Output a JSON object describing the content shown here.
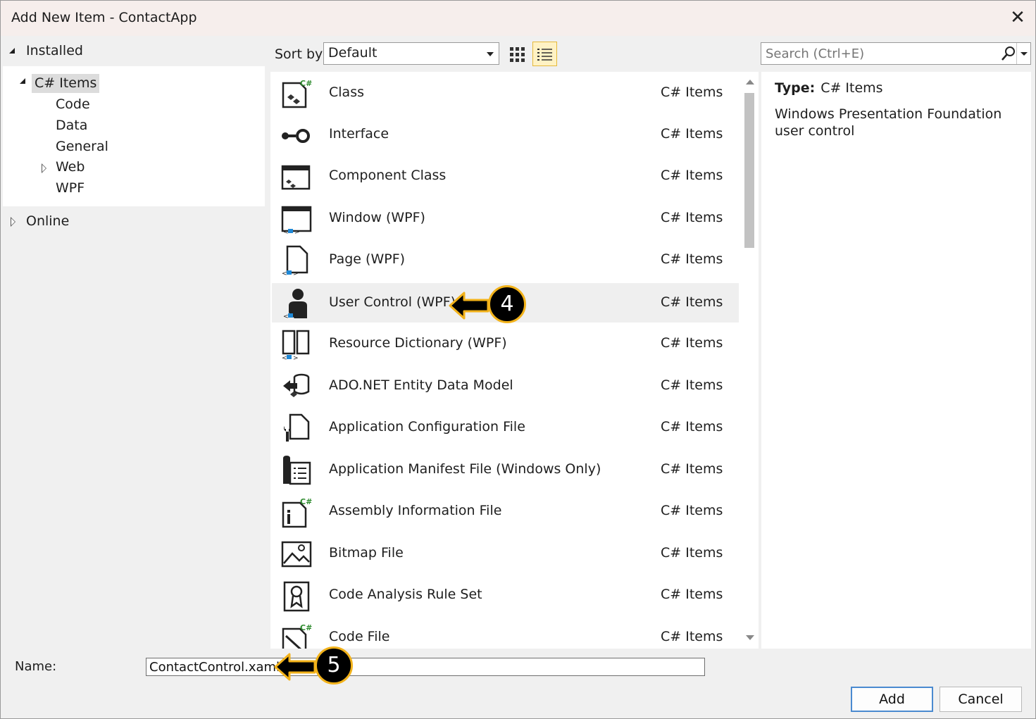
{
  "window": {
    "title": "Add New Item - ContactApp",
    "close_glyph": "✕"
  },
  "tree": {
    "installed_label": "Installed",
    "csharp_items": "C# Items",
    "children": [
      "Code",
      "Data",
      "General",
      "Web",
      "WPF"
    ],
    "online_label": "Online"
  },
  "toolbar": {
    "sort_label": "Sort by:",
    "sort_value": "Default",
    "search_placeholder": "Search (Ctrl+E)"
  },
  "items": [
    {
      "name": "Class",
      "category": "C# Items",
      "icon": "class-icon"
    },
    {
      "name": "Interface",
      "category": "C# Items",
      "icon": "interface-icon"
    },
    {
      "name": "Component Class",
      "category": "C# Items",
      "icon": "component-class-icon"
    },
    {
      "name": "Window (WPF)",
      "category": "C# Items",
      "icon": "wpf-window-icon"
    },
    {
      "name": "Page (WPF)",
      "category": "C# Items",
      "icon": "wpf-page-icon"
    },
    {
      "name": "User Control (WPF)",
      "category": "C# Items",
      "icon": "user-control-icon",
      "selected": true
    },
    {
      "name": "Resource Dictionary (WPF)",
      "category": "C# Items",
      "icon": "resource-dictionary-icon"
    },
    {
      "name": "ADO.NET Entity Data Model",
      "category": "C# Items",
      "icon": "entity-model-icon"
    },
    {
      "name": "Application Configuration File",
      "category": "C# Items",
      "icon": "config-file-icon"
    },
    {
      "name": "Application Manifest File (Windows Only)",
      "category": "C# Items",
      "icon": "manifest-file-icon"
    },
    {
      "name": "Assembly Information File",
      "category": "C# Items",
      "icon": "assembly-info-icon"
    },
    {
      "name": "Bitmap File",
      "category": "C# Items",
      "icon": "bitmap-file-icon"
    },
    {
      "name": "Code Analysis Rule Set",
      "category": "C# Items",
      "icon": "rule-set-icon"
    },
    {
      "name": "Code File",
      "category": "C# Items",
      "icon": "code-file-icon"
    }
  ],
  "details": {
    "type_label": "Type:",
    "type_value": "C# Items",
    "description": "Windows Presentation Foundation user control"
  },
  "bottom": {
    "name_label": "Name:",
    "name_value": "ContactControl.xaml",
    "add_label": "Add",
    "cancel_label": "Cancel"
  },
  "callouts": {
    "step_4": "4",
    "step_5": "5",
    "accent": "#f2b21a"
  }
}
